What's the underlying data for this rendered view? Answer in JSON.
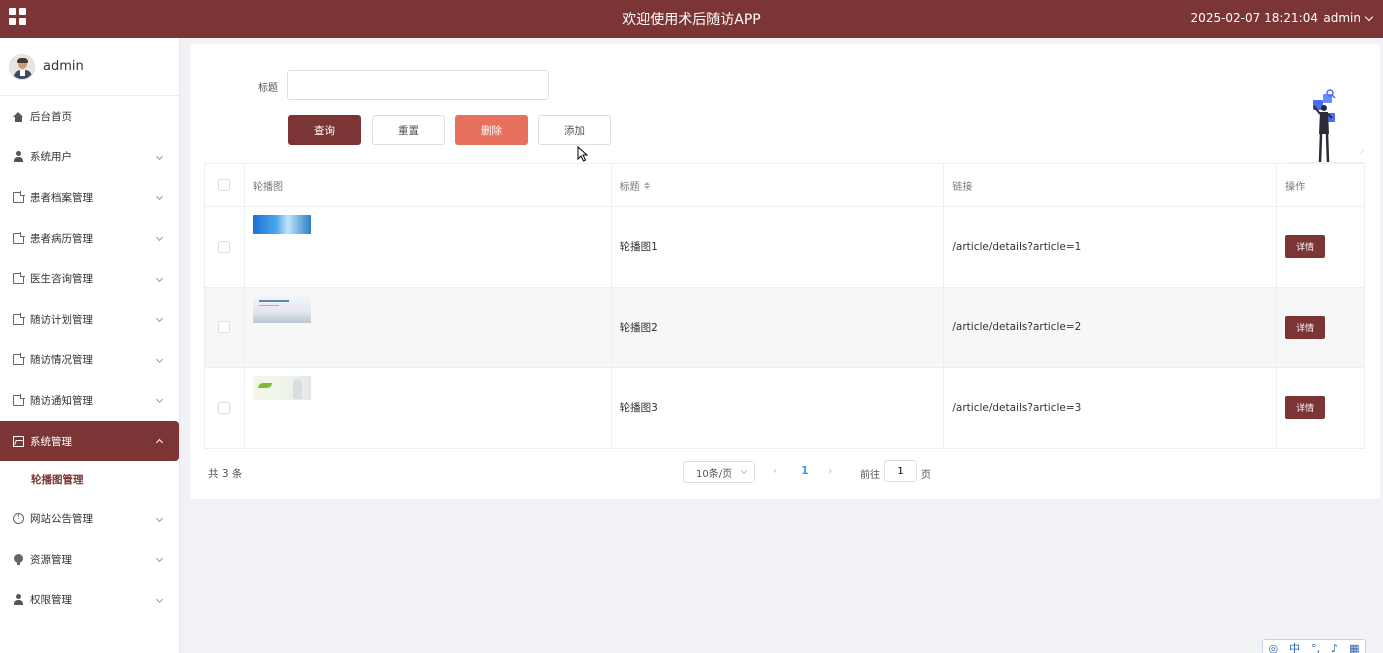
{
  "header": {
    "app_title": "欢迎使用术后随访APP",
    "datetime": "2025-02-07 18:21:04",
    "user": "admin"
  },
  "sidebar": {
    "username": "admin",
    "items": [
      {
        "label": "后台首页",
        "icon": "home-icon"
      },
      {
        "label": "系统用户",
        "icon": "user-icon"
      },
      {
        "label": "患者档案管理",
        "icon": "document-icon"
      },
      {
        "label": "患者病历管理",
        "icon": "document-icon"
      },
      {
        "label": "医生咨询管理",
        "icon": "document-icon"
      },
      {
        "label": "随访计划管理",
        "icon": "document-icon"
      },
      {
        "label": "随访情况管理",
        "icon": "document-icon"
      },
      {
        "label": "随访通知管理",
        "icon": "document-icon"
      },
      {
        "label": "系统管理",
        "icon": "image-icon"
      },
      {
        "label": "网站公告管理",
        "icon": "info-icon"
      },
      {
        "label": "资源管理",
        "icon": "bulb-icon"
      },
      {
        "label": "权限管理",
        "icon": "user-icon"
      }
    ],
    "submenu": {
      "label": "轮播图管理"
    }
  },
  "search": {
    "label": "标题",
    "value": "",
    "placeholder": ""
  },
  "toolbar": {
    "query": "查询",
    "reset": "重置",
    "delete": "删除",
    "add": "添加"
  },
  "table": {
    "columns": {
      "image": "轮播图",
      "title": "标题",
      "link": "链接",
      "op": "操作"
    },
    "rows": [
      {
        "title": "轮播图1",
        "link": "/article/details?article=1",
        "action": "详情"
      },
      {
        "title": "轮播图2",
        "link": "/article/details?article=2",
        "action": "详情"
      },
      {
        "title": "轮播图3",
        "link": "/article/details?article=3",
        "action": "详情"
      }
    ]
  },
  "pagination": {
    "total": "共 3 条",
    "page_size": "10条/页",
    "prev": "‹",
    "current": "1",
    "next": "›",
    "goto_label": "前往",
    "goto_value": "1",
    "goto_suffix": "页"
  },
  "ime": {
    "lang": "中"
  },
  "colors": {
    "primary": "#7b3535",
    "danger": "#e8705e",
    "link": "#409eff"
  }
}
